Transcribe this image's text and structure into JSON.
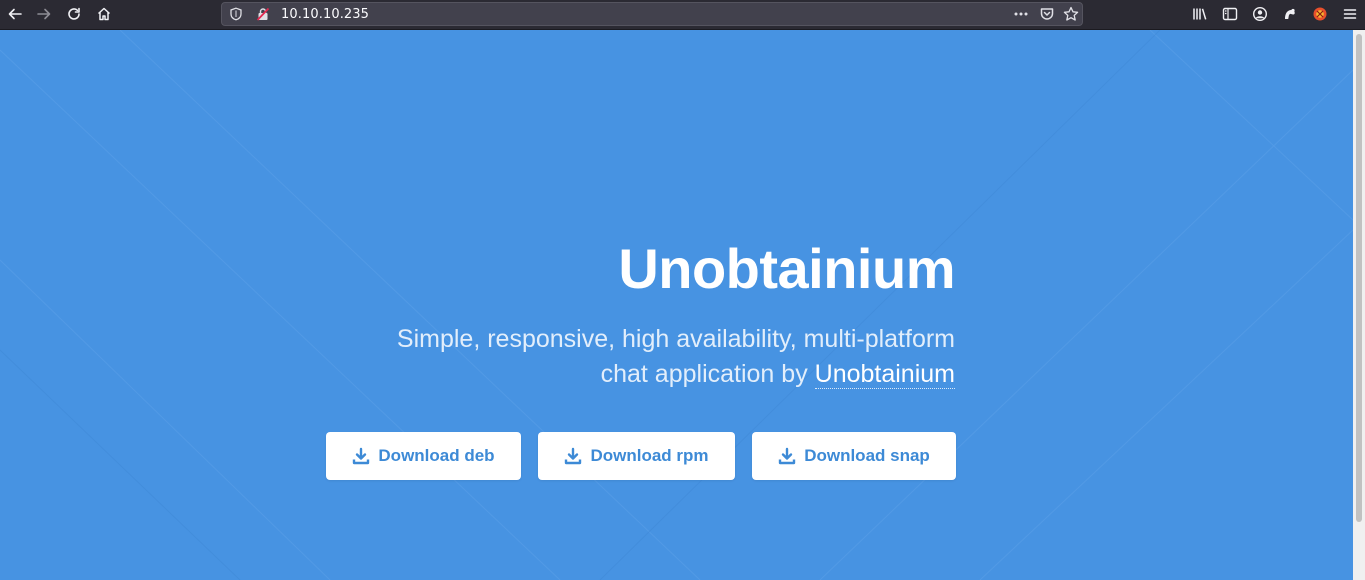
{
  "browser": {
    "url": "10.10.10.235",
    "icons": [
      "back-icon",
      "forward-icon",
      "reload-icon",
      "home-icon",
      "shield-icon",
      "insecure-lock-icon",
      "more-dots-icon",
      "pocket-icon",
      "bookmark-star-icon",
      "library-icon",
      "sidebar-icon",
      "account-icon",
      "extension-icon",
      "firefox-extension-icon",
      "menu-icon"
    ]
  },
  "page": {
    "title": "Unobtainium",
    "subtitle_line1": "Simple, responsive, high availability, multi-platform",
    "subtitle_line2_prefix": "chat application by ",
    "subtitle_link": "Unobtainium",
    "buttons": [
      {
        "label": "Download deb"
      },
      {
        "label": "Download rpm"
      },
      {
        "label": "Download snap"
      }
    ]
  },
  "colors": {
    "background": "#4793e2",
    "button_bg": "#ffffff",
    "button_text": "#3d8ad6",
    "toolbar": "#2b2a33"
  }
}
